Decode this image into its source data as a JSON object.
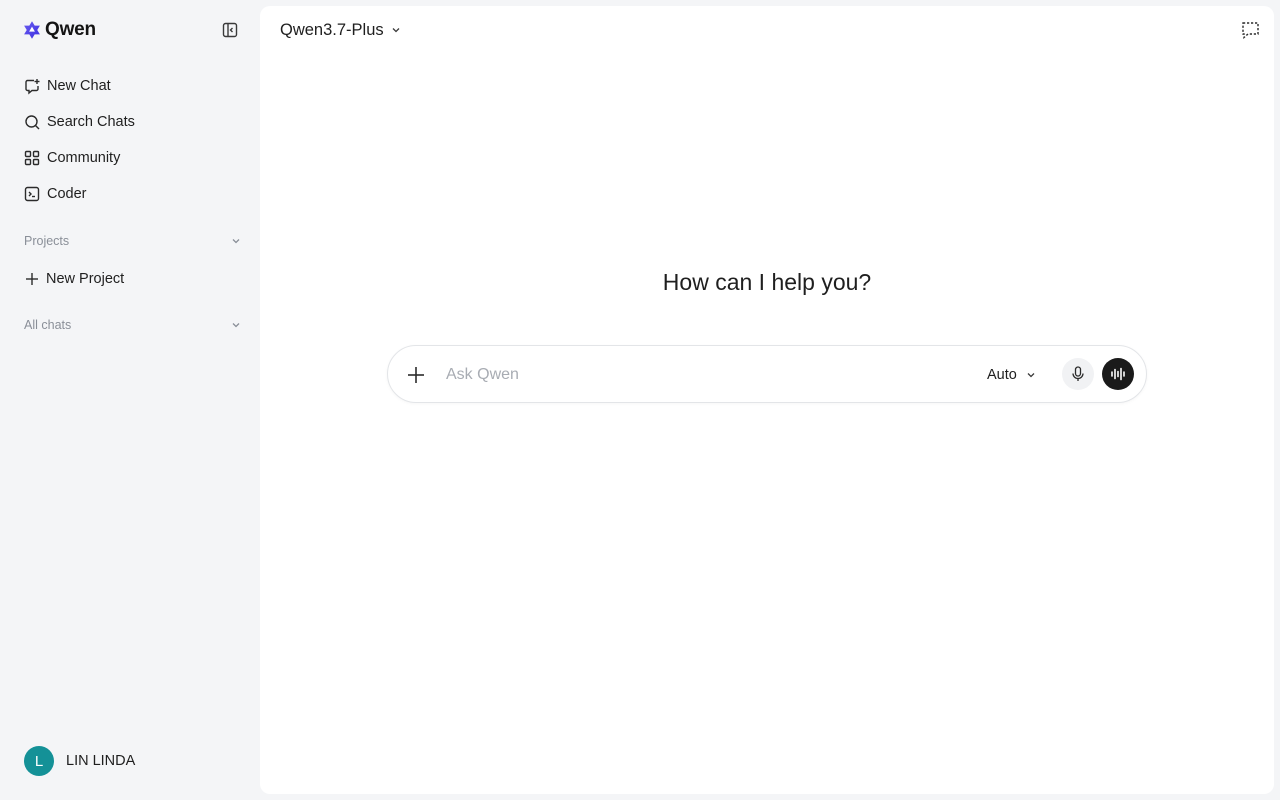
{
  "app": {
    "brand_name": "Qwen",
    "brand_color": "#615ced"
  },
  "sidebar": {
    "nav_items": [
      {
        "label": "New Chat",
        "icon": "new-chat-icon"
      },
      {
        "label": "Search Chats",
        "icon": "search-icon"
      },
      {
        "label": "Community",
        "icon": "grid-icon"
      },
      {
        "label": "Coder",
        "icon": "terminal-icon"
      }
    ],
    "projects_label": "Projects",
    "new_project_label": "New Project",
    "all_chats_label": "All chats",
    "user": {
      "initial": "L",
      "name": "LIN LINDA",
      "avatar_color": "#149197"
    }
  },
  "main": {
    "model_name": "Qwen3.7-Plus",
    "greeting": "How can I help you?",
    "composer": {
      "placeholder": "Ask Qwen",
      "mode": "Auto"
    }
  }
}
